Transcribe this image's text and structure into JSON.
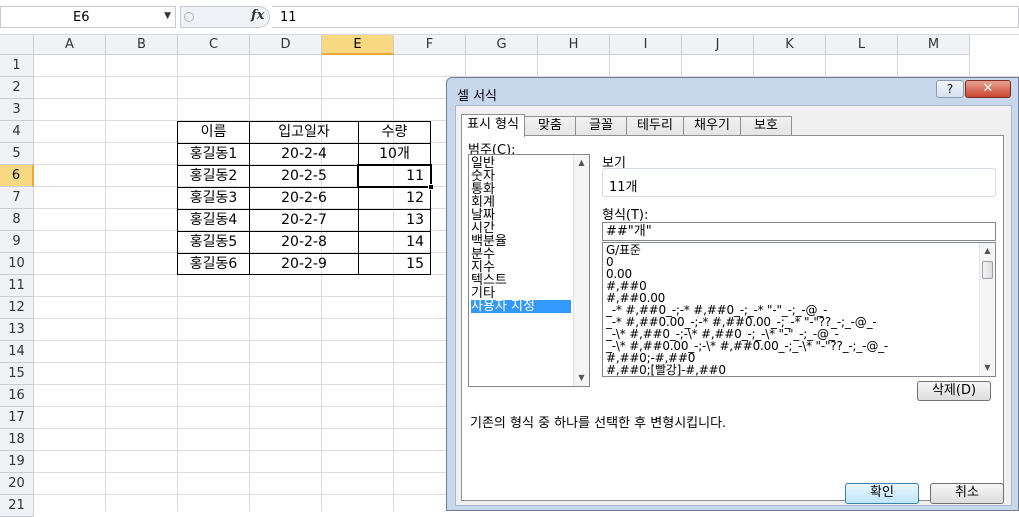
{
  "formula_bar": {
    "name_box": "E6",
    "fx": "fx",
    "formula": "11"
  },
  "columns": [
    "A",
    "B",
    "C",
    "D",
    "E",
    "F",
    "G",
    "H",
    "I",
    "J",
    "K",
    "L",
    "M"
  ],
  "selected_column": "E",
  "rows": [
    "1",
    "2",
    "3",
    "4",
    "5",
    "6",
    "7",
    "8",
    "9",
    "10",
    "11",
    "12",
    "13",
    "14",
    "15",
    "16",
    "17",
    "18",
    "19",
    "20",
    "21"
  ],
  "selected_row": "6",
  "table": {
    "headers": [
      "이름",
      "입고일자",
      "수량"
    ],
    "rows": [
      {
        "name": "홍길동1",
        "date": "20-2-4",
        "qty": "10개"
      },
      {
        "name": "홍길동2",
        "date": "20-2-5",
        "qty": "11"
      },
      {
        "name": "홍길동3",
        "date": "20-2-6",
        "qty": "12"
      },
      {
        "name": "홍길동4",
        "date": "20-2-7",
        "qty": "13"
      },
      {
        "name": "홍길동5",
        "date": "20-2-8",
        "qty": "14"
      },
      {
        "name": "홍길동6",
        "date": "20-2-9",
        "qty": "15"
      }
    ]
  },
  "dialog": {
    "title": "셀 서식",
    "help": "?",
    "close": "✕",
    "tabs": [
      "표시 형식",
      "맞춤",
      "글꼴",
      "테두리",
      "채우기",
      "보호"
    ],
    "active_tab": "표시 형식",
    "category_label": "범주(C):",
    "categories": [
      "일반",
      "숫자",
      "통화",
      "회계",
      "날짜",
      "시간",
      "백분율",
      "분수",
      "지수",
      "텍스트",
      "기타",
      "사용자 지정"
    ],
    "selected_category": "사용자 지정",
    "sample_label": "보기",
    "sample_value": "11개",
    "format_label": "형식(T):",
    "format_value": "##\"개\"",
    "format_list": [
      "G/표준",
      "0",
      "0.00",
      "#,##0",
      "#,##0.00",
      "_-* #,##0_-;-* #,##0_-;_-* \"-\"_-;_-@_-",
      "_-* #,##0.00_-;-* #,##0.00_-;_-* \"-\"??_-;_-@_-",
      "_-\\* #,##0_-;-\\* #,##0_-;_-\\* \"-\"_-;_-@_-",
      "_-\\* #,##0.00_-;-\\* #,##0.00_-;_-\\* \"-\"??_-;_-@_-",
      "#,##0;-#,##0",
      "#,##0;[빨강]-#,##0"
    ],
    "delete_button": "삭제(D)",
    "description": "기존의 형식 중 하나를 선택한 후 변형시킵니다.",
    "ok_button": "확인",
    "cancel_button": "취소"
  }
}
